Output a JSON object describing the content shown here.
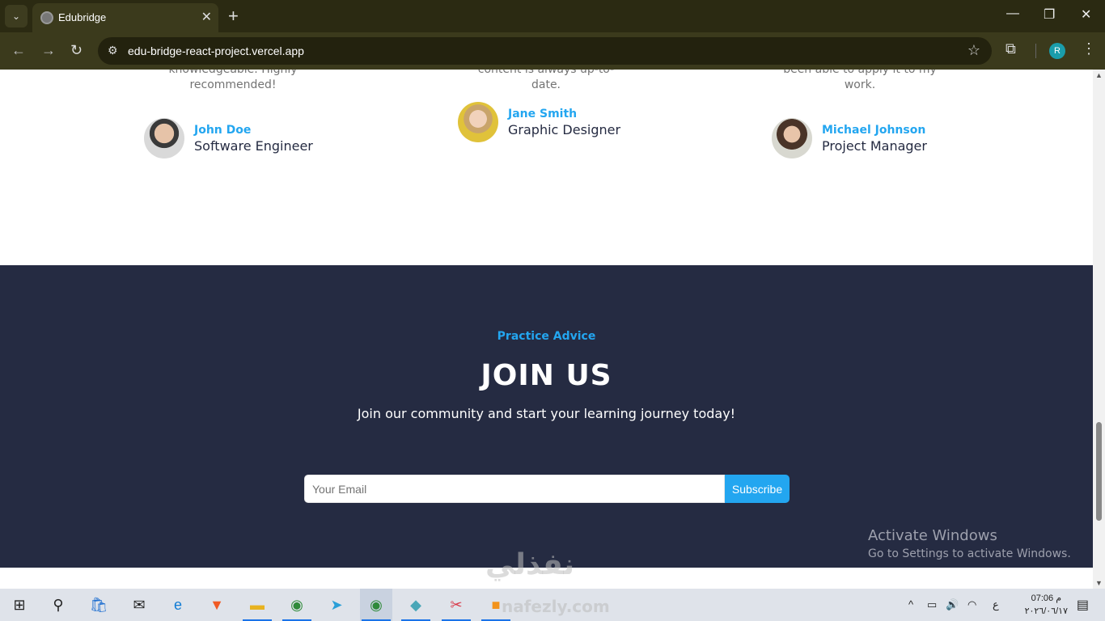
{
  "browser": {
    "tab_title": "Edubridge",
    "url": "edu-bridge-react-project.vercel.app",
    "profile_initial": "R",
    "new_tab": "+",
    "close_tab": "✕"
  },
  "testimonials": [
    {
      "quote_tail": "knowledgeable. Highly recommended!",
      "name": "John Doe",
      "role": "Software Engineer"
    },
    {
      "quote_tail": "content is always up-to-date.",
      "name": "Jane Smith",
      "role": "Graphic Designer"
    },
    {
      "quote_tail": "been able to apply it to my work.",
      "name": "Michael Johnson",
      "role": "Project Manager"
    }
  ],
  "join": {
    "subtitle": "Practice Advice",
    "title": "JOIN US",
    "description": "Join our community and start your learning journey today!",
    "email_placeholder": "Your Email",
    "subscribe_label": "Subscribe"
  },
  "watermark": {
    "title": "Activate Windows",
    "subtitle": "Go to Settings to activate Windows."
  },
  "overlay_logo": {
    "arabic": "نفذلي",
    "latin": "nafezly.com"
  },
  "taskbar": {
    "time": "07:06 م",
    "date": "٢٠٢٦/٠٦/١٧",
    "lang": "ع"
  },
  "colors": {
    "accent": "#23a6f0",
    "dark_section": "#252b42",
    "browser_frame": "#3b3a1c"
  }
}
